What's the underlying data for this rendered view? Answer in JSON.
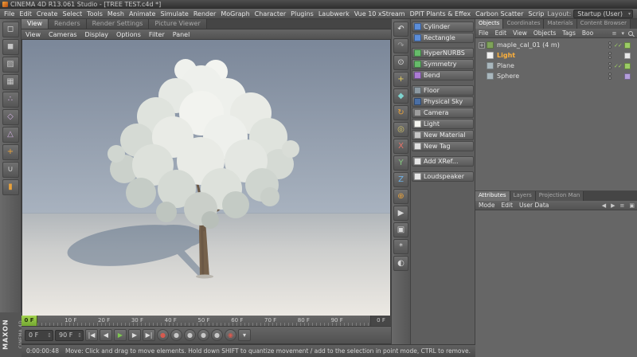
{
  "title_bar": {
    "title": "CINEMA 4D R13.061 Studio - [TREE TEST.c4d *]"
  },
  "menu_bar": {
    "items": [
      "File",
      "Edit",
      "Create",
      "Select",
      "Tools",
      "Mesh",
      "Animate",
      "Simulate",
      "Render",
      "MoGraph",
      "Character",
      "Plugins",
      "Laubwerk",
      "Vue 10 xStream",
      "DPIT Plants & Effex",
      "Carbon Scatter",
      "Scrip"
    ],
    "layout_label": "Layout:",
    "layout_value": "Startup (User)"
  },
  "layout_tabs": {
    "tabs": [
      {
        "label": "View",
        "state": "active"
      },
      {
        "label": "Renders",
        "state": ""
      },
      {
        "label": "Render Settings",
        "state": ""
      },
      {
        "label": "Picture Viewer",
        "state": ""
      }
    ]
  },
  "viewport": {
    "menu": [
      "View",
      "Cameras",
      "Display",
      "Options",
      "Filter",
      "Panel"
    ]
  },
  "left_toolbar": {
    "icons": [
      {
        "name": "make-editable-icon",
        "glyph": "◻",
        "color": "#dcdcdc"
      },
      {
        "name": "model-mode-icon",
        "glyph": "◼",
        "color": "#c6c6c6"
      },
      {
        "name": "texture-mode-icon",
        "glyph": "▨",
        "color": "#c6c6c6"
      },
      {
        "name": "workplane-icon",
        "glyph": "▦",
        "color": "#c6c6c6"
      },
      {
        "name": "points-mode-icon",
        "glyph": "∴",
        "color": "#cfaede"
      },
      {
        "name": "edges-mode-icon",
        "glyph": "◇",
        "color": "#cfaede"
      },
      {
        "name": "polygons-mode-icon",
        "glyph": "△",
        "color": "#cfaede"
      },
      {
        "name": "axis-mode-icon",
        "glyph": "+",
        "color": "#e8a23c"
      },
      {
        "name": "snap-icon",
        "glyph": "∪",
        "color": "#d0d0d0"
      },
      {
        "name": "lock-icon",
        "glyph": "▮",
        "color": "#e8a23c"
      }
    ]
  },
  "mid_toolbar": {
    "icons": [
      {
        "name": "undo-icon",
        "glyph": "↶",
        "color": "#eaeaea"
      },
      {
        "name": "redo-icon",
        "glyph": "↷",
        "color": "#9d9d9d"
      },
      {
        "name": "live-selection-icon",
        "glyph": "⊙",
        "color": "#dcdcdc"
      },
      {
        "name": "move-tool-icon",
        "glyph": "+",
        "color": "#e3cf62"
      },
      {
        "name": "scale-tool-icon",
        "glyph": "◆",
        "color": "#7fd4cf"
      },
      {
        "name": "rotate-tool-icon",
        "glyph": "↻",
        "color": "#e8a23c"
      },
      {
        "name": "last-tool-icon",
        "glyph": "◎",
        "color": "#d9c96a"
      },
      {
        "name": "x-axis-lock-icon",
        "glyph": "X",
        "color": "#e57368"
      },
      {
        "name": "y-axis-lock-icon",
        "glyph": "Y",
        "color": "#85c97f"
      },
      {
        "name": "z-axis-lock-icon",
        "glyph": "Z",
        "color": "#6fb3e8"
      },
      {
        "name": "coordinate-system-icon",
        "glyph": "⊕",
        "color": "#e8a23c"
      },
      {
        "name": "render-view-icon",
        "glyph": "▶",
        "color": "#d8d8d8"
      },
      {
        "name": "render-picture-viewer-icon",
        "glyph": "▣",
        "color": "#d8d8d8"
      },
      {
        "name": "render-settings-icon",
        "glyph": "*",
        "color": "#d8d8d8"
      },
      {
        "name": "display-filter-icon",
        "glyph": "◐",
        "color": "#d8d8d8"
      }
    ]
  },
  "command_panel": {
    "buttons": [
      {
        "label": "Cylinder",
        "color": "#5b8dd9",
        "state": ""
      },
      {
        "label": "Rectangle",
        "color": "#5b8dd9",
        "state": ""
      },
      {
        "label": "HyperNURBS",
        "color": "#66bb6a",
        "state": "gap"
      },
      {
        "label": "Symmetry",
        "color": "#66bb6a",
        "state": ""
      },
      {
        "label": "Bend",
        "color": "#ab7bd4",
        "state": ""
      },
      {
        "label": "Floor",
        "color": "#8d9aa2",
        "state": "gap"
      },
      {
        "label": "Physical Sky",
        "color": "#4a6fa5",
        "state": ""
      },
      {
        "label": "Camera",
        "color": "#9e9e9e",
        "state": ""
      },
      {
        "label": "Light",
        "color": "#f5f5f0",
        "state": ""
      },
      {
        "label": "New Material",
        "color": "#c7c7c7",
        "state": ""
      },
      {
        "label": "New Tag",
        "color": "#e0e0e0",
        "state": ""
      },
      {
        "label": "Add XRef...",
        "color": "#e6e6e6",
        "state": "gap"
      },
      {
        "label": "Loudspeaker",
        "color": "#e6e6e6",
        "state": "gap"
      }
    ]
  },
  "objects_panel": {
    "tabs": [
      {
        "label": "Objects",
        "state": "active"
      },
      {
        "label": "Coordinates",
        "state": ""
      },
      {
        "label": "Materials",
        "state": ""
      },
      {
        "label": "Content Browser",
        "state": ""
      }
    ],
    "menu": [
      "File",
      "Edit",
      "View",
      "Objects",
      "Tags",
      "Boo"
    ],
    "menu_icons": [
      {
        "name": "filter-icon",
        "glyph": "≡"
      },
      {
        "name": "options-arrow-icon",
        "glyph": "▾"
      }
    ],
    "rows": [
      {
        "expander": "+",
        "label": "maple_cal_01 (4 m)",
        "state": "",
        "icon_color": "#7fa35a",
        "checks": "✓✓",
        "tag_color": "#9ccc65"
      },
      {
        "expander": "",
        "label": "Light",
        "state": "selected",
        "icon_color": "#f2f2f2",
        "checks": "",
        "tag_color": "#e8e8e8"
      },
      {
        "expander": "",
        "label": "Plane",
        "state": "",
        "icon_color": "#a9b7bd",
        "checks": "✓✓",
        "tag_color": "#9ccc65"
      },
      {
        "expander": "",
        "label": "Sphere",
        "state": "",
        "icon_color": "#a9b7bd",
        "checks": "",
        "tag_color": "#b39ddb"
      }
    ]
  },
  "attributes_panel": {
    "tabs": [
      {
        "label": "Attributes",
        "state": "active"
      },
      {
        "label": "Layers",
        "state": ""
      },
      {
        "label": "Projection Man",
        "state": ""
      }
    ],
    "menu": [
      "Mode",
      "Edit",
      "User Data"
    ],
    "nav_icons": [
      {
        "name": "history-back-icon",
        "glyph": "◀"
      },
      {
        "name": "history-forward-icon",
        "glyph": "▶"
      },
      {
        "name": "panel-options-icon",
        "glyph": "≡"
      },
      {
        "name": "lock-panel-icon",
        "glyph": "▣"
      }
    ]
  },
  "timeline": {
    "marker": "0 F",
    "ticks": [
      "10 F",
      "20 F",
      "30 F",
      "40 F",
      "50 F",
      "60 F",
      "70 F",
      "80 F",
      "90 F"
    ],
    "current": "0 F"
  },
  "transport": {
    "start": "0 F",
    "end": "90 F",
    "buttons": [
      {
        "name": "goto-start-button",
        "glyph": "|◀",
        "color": "#ddd",
        "shape": ""
      },
      {
        "name": "prev-frame-button",
        "glyph": "◀",
        "color": "#ddd",
        "shape": ""
      },
      {
        "name": "play-button",
        "glyph": "▶",
        "color": "#7ec850",
        "shape": ""
      },
      {
        "name": "next-frame-button",
        "glyph": "▶",
        "color": "#ddd",
        "shape": ""
      },
      {
        "name": "goto-end-button",
        "glyph": "▶|",
        "color": "#ddd",
        "shape": ""
      },
      {
        "name": "record-keyframe-button",
        "glyph": "●",
        "color": "#d65a4f",
        "shape": "round"
      },
      {
        "name": "record-position-button",
        "glyph": "●",
        "color": "#c8c8c8",
        "shape": "round"
      },
      {
        "name": "record-scale-button",
        "glyph": "●",
        "color": "#c8c8c8",
        "shape": "round"
      },
      {
        "name": "record-rotation-button",
        "glyph": "●",
        "color": "#c8c8c8",
        "shape": "round"
      },
      {
        "name": "record-parameter-button",
        "glyph": "●",
        "color": "#c8c8c8",
        "shape": "round"
      },
      {
        "name": "autokey-button",
        "glyph": "◉",
        "color": "#d65a4f",
        "shape": "round"
      },
      {
        "name": "playback-options-button",
        "glyph": "▾",
        "color": "#ddd",
        "shape": ""
      }
    ]
  },
  "status_bar": {
    "timecode": "0:00:00:48",
    "message": "Move: Click and drag to move elements. Hold down SHIFT to quantize movement / add to the selection in point mode, CTRL to remove."
  },
  "brand": {
    "line1": "MAXON",
    "line2": "CINEMA 4D"
  }
}
